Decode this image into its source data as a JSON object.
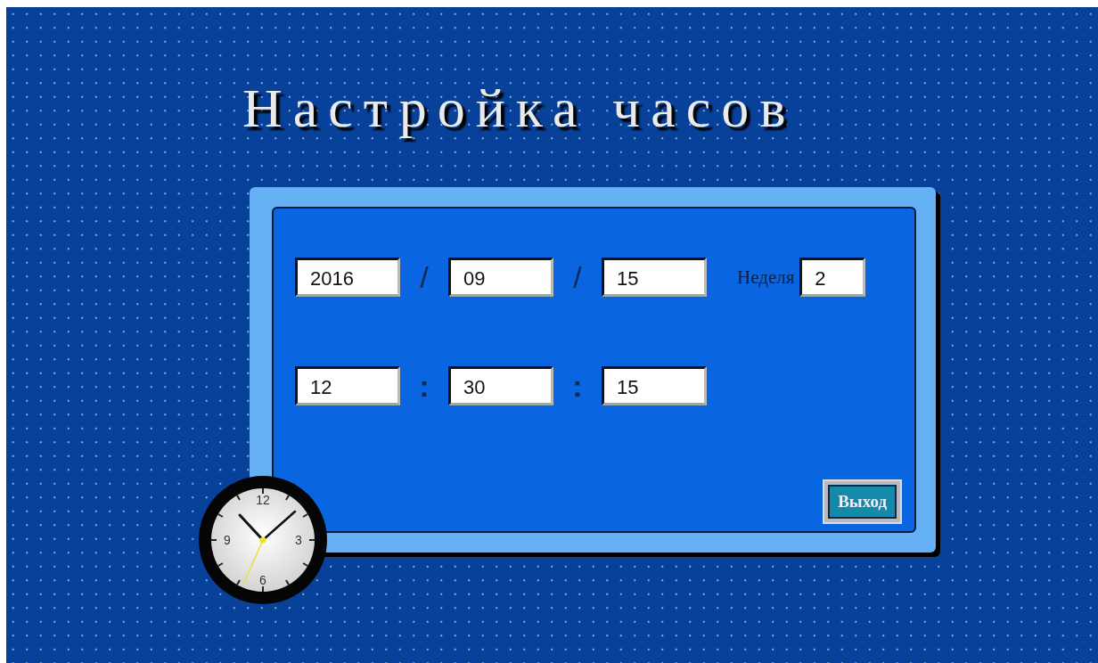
{
  "title": "Настройка часов",
  "date_fields": [
    "2016",
    "09",
    "15"
  ],
  "date_separator": "/",
  "week": {
    "label": "Неделя",
    "value": "2"
  },
  "time_fields": [
    "12",
    "30",
    "15"
  ],
  "time_separator": ":",
  "exit_button": "Выход",
  "clock": {
    "numerals": [
      "12",
      "3",
      "6",
      "9"
    ]
  }
}
